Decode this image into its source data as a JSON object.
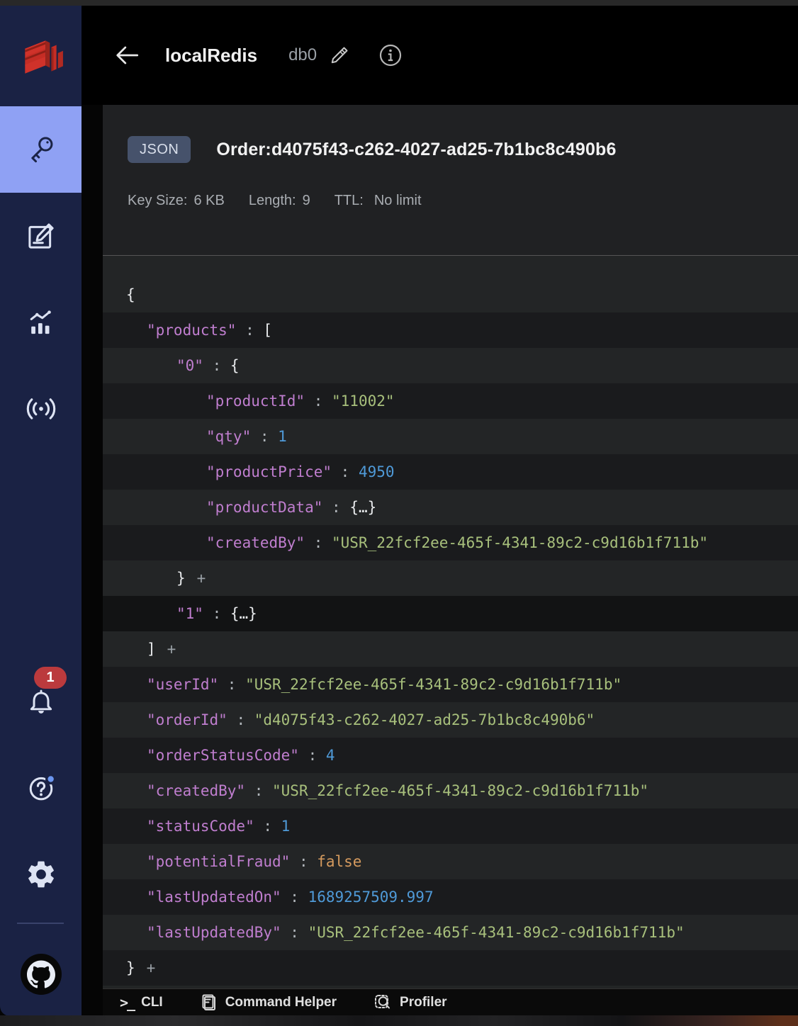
{
  "colors": {
    "sidebar": "#1a2244",
    "accent_active": "#8fa1f4",
    "badge_red": "#bb3a3d",
    "dot_blue": "#6b96f0",
    "badge_bg": "#46526b",
    "row_light": "#232526",
    "row_dark": "#1a1b1d",
    "key": "#c07ecf",
    "string": "#a8c07c",
    "number": "#4f9ad8",
    "boolean": "#d49a5e",
    "redis_red": "#d0322a"
  },
  "sidebar": {
    "logo_icon": "redis-logo",
    "nav": [
      {
        "id": "browser",
        "icon": "key-icon",
        "active": true
      },
      {
        "id": "workbench",
        "icon": "workbench-icon",
        "active": false
      },
      {
        "id": "analytics",
        "icon": "analytics-icon",
        "active": false
      },
      {
        "id": "pubsub",
        "icon": "pubsub-icon",
        "active": false
      },
      {
        "id": "notifications",
        "icon": "bell-icon",
        "active": false
      },
      {
        "id": "help",
        "icon": "help-icon",
        "active": false
      },
      {
        "id": "settings",
        "icon": "gear-icon",
        "active": false
      },
      {
        "id": "github",
        "icon": "github-icon",
        "active": false
      }
    ],
    "notifications_badge": "1"
  },
  "header": {
    "back_icon": "arrow-left-icon",
    "db_name": "localRedis",
    "db_index": "db0",
    "edit_icon": "pencil-icon",
    "info_icon": "info-icon"
  },
  "key_panel": {
    "type_badge": "JSON",
    "key_name": "Order:d4075f43-c262-4027-ad25-7b1bc8c490b6",
    "meta": {
      "key_size_label": "Key Size:",
      "key_size_value": "6 KB",
      "length_label": "Length:",
      "length_value": "9",
      "ttl_label": "TTL:",
      "ttl_value": "No limit"
    }
  },
  "json_view": {
    "rows": [
      {
        "indent": 0,
        "segments": [
          {
            "type": "punct",
            "text": "{"
          }
        ]
      },
      {
        "indent": 1,
        "segments": [
          {
            "type": "key",
            "text": "\"products\""
          },
          {
            "type": "colon",
            "text": " : "
          },
          {
            "type": "punct",
            "text": "["
          }
        ]
      },
      {
        "indent": 2,
        "segments": [
          {
            "type": "key",
            "text": "\"0\""
          },
          {
            "type": "colon",
            "text": " : "
          },
          {
            "type": "punct",
            "text": "{"
          }
        ]
      },
      {
        "indent": 3,
        "segments": [
          {
            "type": "key",
            "text": "\"productId\""
          },
          {
            "type": "colon",
            "text": " : "
          },
          {
            "type": "string",
            "text": "\"11002\""
          }
        ]
      },
      {
        "indent": 3,
        "segments": [
          {
            "type": "key",
            "text": "\"qty\""
          },
          {
            "type": "colon",
            "text": " : "
          },
          {
            "type": "number",
            "text": "1"
          }
        ]
      },
      {
        "indent": 3,
        "segments": [
          {
            "type": "key",
            "text": "\"productPrice\""
          },
          {
            "type": "colon",
            "text": " : "
          },
          {
            "type": "number",
            "text": "4950"
          }
        ]
      },
      {
        "indent": 3,
        "segments": [
          {
            "type": "key",
            "text": "\"productData\""
          },
          {
            "type": "colon",
            "text": " : "
          },
          {
            "type": "collapsed",
            "text": "{…}"
          }
        ]
      },
      {
        "indent": 3,
        "segments": [
          {
            "type": "key",
            "text": "\"createdBy\""
          },
          {
            "type": "colon",
            "text": " : "
          },
          {
            "type": "string",
            "text": "\"USR_22fcf2ee-465f-4341-89c2-c9d16b1f711b\""
          }
        ]
      },
      {
        "indent": 2,
        "segments": [
          {
            "type": "punct",
            "text": "}"
          },
          {
            "type": "expand",
            "text": "+"
          }
        ]
      },
      {
        "indent": 2,
        "variant": "darkest",
        "segments": [
          {
            "type": "key",
            "text": "\"1\""
          },
          {
            "type": "colon",
            "text": " : "
          },
          {
            "type": "collapsed",
            "text": "{…}"
          }
        ]
      },
      {
        "indent": 1,
        "segments": [
          {
            "type": "punct",
            "text": "]"
          },
          {
            "type": "expand",
            "text": "+"
          }
        ]
      },
      {
        "indent": 1,
        "segments": [
          {
            "type": "key",
            "text": "\"userId\""
          },
          {
            "type": "colon",
            "text": " : "
          },
          {
            "type": "string",
            "text": "\"USR_22fcf2ee-465f-4341-89c2-c9d16b1f711b\""
          }
        ]
      },
      {
        "indent": 1,
        "segments": [
          {
            "type": "key",
            "text": "\"orderId\""
          },
          {
            "type": "colon",
            "text": " : "
          },
          {
            "type": "string",
            "text": "\"d4075f43-c262-4027-ad25-7b1bc8c490b6\""
          }
        ]
      },
      {
        "indent": 1,
        "segments": [
          {
            "type": "key",
            "text": "\"orderStatusCode\""
          },
          {
            "type": "colon",
            "text": " : "
          },
          {
            "type": "number",
            "text": "4"
          }
        ]
      },
      {
        "indent": 1,
        "segments": [
          {
            "type": "key",
            "text": "\"createdBy\""
          },
          {
            "type": "colon",
            "text": " : "
          },
          {
            "type": "string",
            "text": "\"USR_22fcf2ee-465f-4341-89c2-c9d16b1f711b\""
          }
        ]
      },
      {
        "indent": 1,
        "segments": [
          {
            "type": "key",
            "text": "\"statusCode\""
          },
          {
            "type": "colon",
            "text": " : "
          },
          {
            "type": "number",
            "text": "1"
          }
        ]
      },
      {
        "indent": 1,
        "segments": [
          {
            "type": "key",
            "text": "\"potentialFraud\""
          },
          {
            "type": "colon",
            "text": " : "
          },
          {
            "type": "boolean",
            "text": "false"
          }
        ]
      },
      {
        "indent": 1,
        "segments": [
          {
            "type": "key",
            "text": "\"lastUpdatedOn\""
          },
          {
            "type": "colon",
            "text": " : "
          },
          {
            "type": "number",
            "text": "1689257509.997"
          }
        ]
      },
      {
        "indent": 1,
        "segments": [
          {
            "type": "key",
            "text": "\"lastUpdatedBy\""
          },
          {
            "type": "colon",
            "text": " : "
          },
          {
            "type": "string",
            "text": "\"USR_22fcf2ee-465f-4341-89c2-c9d16b1f711b\""
          }
        ]
      },
      {
        "indent": 0,
        "segments": [
          {
            "type": "punct",
            "text": "}"
          },
          {
            "type": "expand",
            "text": "+"
          }
        ]
      }
    ]
  },
  "bottom_bar": {
    "cli_label": "CLI",
    "cli_icon": "terminal-prompt-icon",
    "command_helper_label": "Command Helper",
    "command_helper_icon": "document-icon",
    "profiler_label": "Profiler",
    "profiler_icon": "magnifier-icon"
  }
}
